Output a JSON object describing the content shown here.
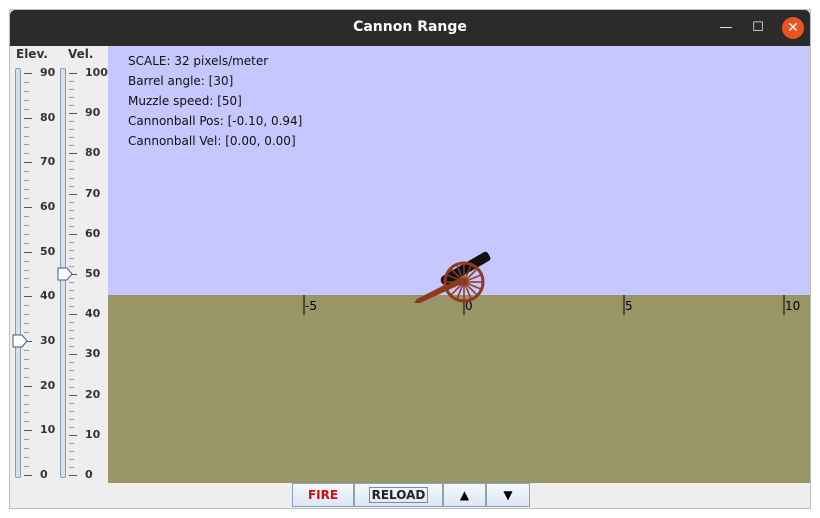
{
  "window": {
    "title": "Cannon Range"
  },
  "sliders": {
    "elevation": {
      "label": "Elev.",
      "min": 0,
      "max": 90,
      "value": 30,
      "tick_labels": [
        "90",
        "80",
        "70",
        "60",
        "50",
        "40",
        "30",
        "20",
        "10",
        "0"
      ]
    },
    "velocity": {
      "label": "Vel.",
      "min": 0,
      "max": 100,
      "value": 50,
      "tick_labels": [
        "100",
        "90",
        "80",
        "70",
        "60",
        "50",
        "40",
        "30",
        "20",
        "10",
        "0"
      ]
    }
  },
  "info": {
    "scale": "SCALE: 32 pixels/meter",
    "barrel_angle": "Barrel angle: [30]",
    "muzzle_speed": "Muzzle speed: [50]",
    "cannonball_pos": "Cannonball Pos: [-0.10, 0.94]",
    "cannonball_vel": "Cannonball Vel: [0.00, 0.00]"
  },
  "ground_axis": {
    "ticks": [
      -5,
      0,
      5,
      10
    ],
    "labels": [
      "-5",
      "0",
      "5",
      "10"
    ]
  },
  "controls": {
    "fire_label": "FIRE",
    "reload_label": "RELOAD",
    "up_label": "▲",
    "down_label": "▼"
  },
  "colors": {
    "sky": "#c7c7ff",
    "ground": "#999566",
    "barrel": "#111111",
    "carriage": "#8b3a1e",
    "fire_text": "#d01010",
    "close_button": "#e95420"
  }
}
